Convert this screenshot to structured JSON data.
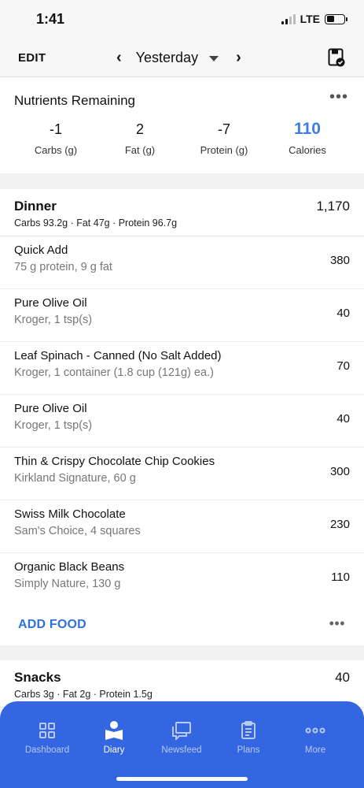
{
  "status": {
    "time": "1:41",
    "network": "LTE"
  },
  "nav": {
    "edit": "EDIT",
    "date": "Yesterday",
    "prev": "‹",
    "next": "›"
  },
  "nutrients": {
    "title": "Nutrients Remaining",
    "more": "•••",
    "items": [
      {
        "value": "-1",
        "label": "Carbs (g)"
      },
      {
        "value": "2",
        "label": "Fat (g)"
      },
      {
        "value": "-7",
        "label": "Protein (g)"
      },
      {
        "value": "110",
        "label": "Calories"
      }
    ]
  },
  "dinner": {
    "name": "Dinner",
    "total": "1,170",
    "macros": "Carbs 93.2g · Fat 47g · Protein 96.7g",
    "foods": [
      {
        "name": "Quick Add",
        "desc": "75 g protein, 9 g fat",
        "cal": "380"
      },
      {
        "name": "Pure Olive Oil",
        "desc": "Kroger, 1 tsp(s)",
        "cal": "40"
      },
      {
        "name": "Leaf Spinach - Canned (No Salt Added)",
        "desc": "Kroger, 1 container (1.8 cup  (121g) ea.)",
        "cal": "70"
      },
      {
        "name": "Pure Olive Oil",
        "desc": "Kroger, 1 tsp(s)",
        "cal": "40"
      },
      {
        "name": "Thin & Crispy Chocolate Chip Cookies",
        "desc": "Kirkland Signature, 60 g",
        "cal": "300"
      },
      {
        "name": "Swiss Milk Chocolate",
        "desc": "Sam's Choice, 4 squares",
        "cal": "230"
      },
      {
        "name": "Organic Black Beans",
        "desc": "Simply Nature, 130 g",
        "cal": "110"
      }
    ],
    "add_food": "ADD FOOD",
    "more": "•••"
  },
  "snacks": {
    "name": "Snacks",
    "total": "40",
    "macros": "Carbs 3g · Fat 2g · Protein 1.5g"
  },
  "tabs": [
    {
      "label": "Dashboard",
      "icon": "dashboard-icon"
    },
    {
      "label": "Diary",
      "icon": "diary-icon"
    },
    {
      "label": "Newsfeed",
      "icon": "newsfeed-icon"
    },
    {
      "label": "Plans",
      "icon": "plans-icon"
    },
    {
      "label": "More",
      "icon": "more-icon"
    }
  ],
  "colors": {
    "accent": "#3d7de8",
    "tab_bar": "#3366e0",
    "add_food": "#2f6fde"
  }
}
